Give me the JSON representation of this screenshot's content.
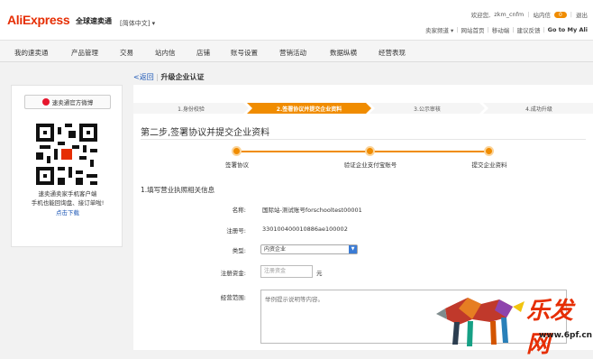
{
  "header": {
    "logo": "AliExpress",
    "logo_sub": "全球速卖通",
    "language": "[简体中文]  ▾",
    "welcome": "欢迎您,",
    "username": "zkm_cnfm",
    "inbox": "站内信",
    "inbox_count": "0",
    "exit": "退出",
    "seller_channel": "卖家频道 ▾",
    "site_home": "网站首页",
    "mobile": "移动端",
    "feedback": "建议反馈",
    "goto_my_ali": "Go to My Ali"
  },
  "nav": [
    "我的速卖通",
    "产品管理",
    "交易",
    "站内信",
    "店铺",
    "账号设置",
    "营销活动",
    "数据纵横",
    "经营表现"
  ],
  "breadcrumb": {
    "back": "<返回",
    "title": "升级企业认证"
  },
  "sidebar": {
    "weibo": "速卖通官方微博",
    "line1": "速卖通卖家手机客户端",
    "line2": "手机也能回询盘、接订单啦!",
    "download": "点击下载"
  },
  "steps": [
    "1.身份校验",
    "2.签署协议并提交企业资料",
    "3.公示审核",
    "4.成功升级"
  ],
  "active_step": 2,
  "step_title": "第二步,签署协议并提交企业资料",
  "progress": [
    "签署协议",
    "验证企业支付宝账号",
    "提交企业资料"
  ],
  "section_title": "1.填写营业执照相关信息",
  "form": {
    "name_label": "名称:",
    "name_value": "国际站-测试账号forschooltest00001",
    "reg_label": "注册号:",
    "reg_value": "330100400010886ae100002",
    "type_label": "类型:",
    "type_value": "内资企业",
    "capital_label": "注册资金:",
    "capital_placeholder": "注册资金",
    "capital_unit": "元",
    "scope_label": "经营范围:",
    "scope_placeholder": "举例提示说明等内容。"
  },
  "watermark": {
    "text": "乐发网",
    "url": "www.6pf.cn"
  },
  "colors": {
    "accent": "#f08c00",
    "brand": "#e62e04",
    "link": "#1a55b5"
  }
}
